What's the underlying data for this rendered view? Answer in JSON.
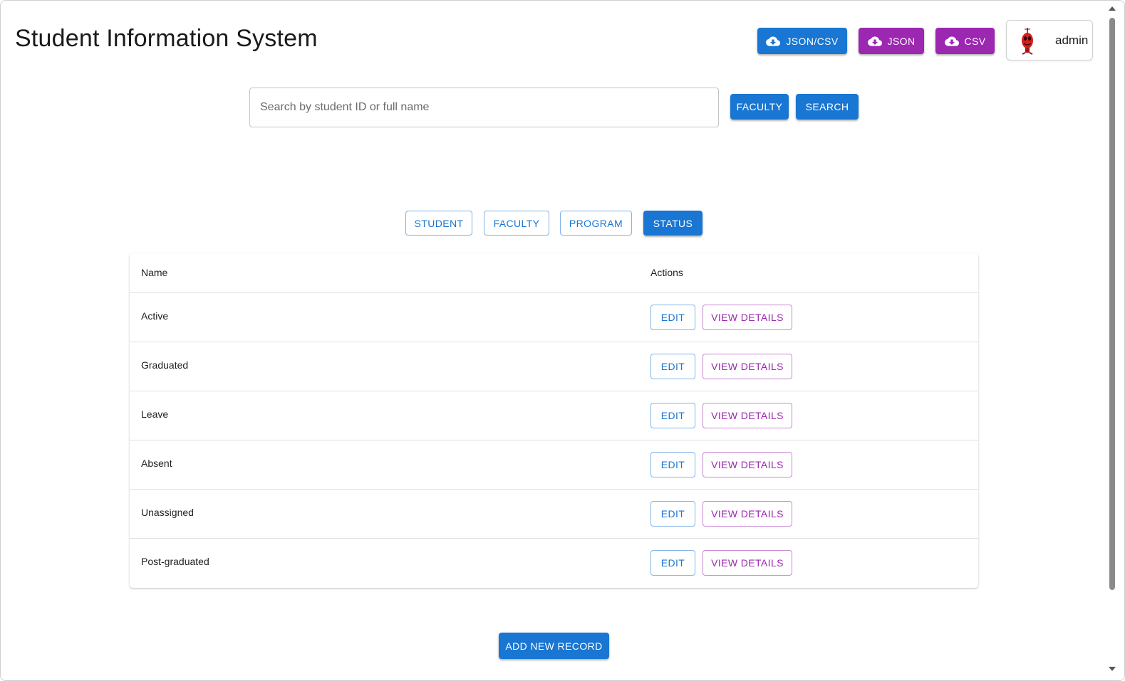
{
  "header": {
    "title": "Student Information System",
    "actions": [
      {
        "label": "JSON/CSV",
        "icon": "cloud-download-icon",
        "color": "#1976d2"
      },
      {
        "label": "JSON",
        "icon": "cloud-download-icon",
        "color": "#9c27b0"
      },
      {
        "label": "CSV",
        "icon": "cloud-download-icon",
        "color": "#9c27b0"
      }
    ],
    "user": {
      "name": "admin",
      "avatar": "avatar-icon"
    }
  },
  "search": {
    "placeholder": "Search by student ID or full name",
    "value": "",
    "faculty_label": "FACULTY",
    "search_label": "SEARCH"
  },
  "tabs": [
    {
      "label": "STUDENT",
      "active": false
    },
    {
      "label": "FACULTY",
      "active": false
    },
    {
      "label": "PROGRAM",
      "active": false
    },
    {
      "label": "STATUS",
      "active": true
    }
  ],
  "table": {
    "columns": [
      "Name",
      "Actions"
    ],
    "rows": [
      {
        "name": "Active",
        "edit": "EDIT",
        "view": "VIEW DETAILS"
      },
      {
        "name": "Graduated",
        "edit": "EDIT",
        "view": "VIEW DETAILS"
      },
      {
        "name": "Leave",
        "edit": "EDIT",
        "view": "VIEW DETAILS"
      },
      {
        "name": "Absent",
        "edit": "EDIT",
        "view": "VIEW DETAILS"
      },
      {
        "name": "Unassigned",
        "edit": "EDIT",
        "view": "VIEW DETAILS"
      },
      {
        "name": "Post-graduated",
        "edit": "EDIT",
        "view": "VIEW DETAILS"
      }
    ]
  },
  "footer": {
    "add_label": "ADD NEW RECORD"
  },
  "colors": {
    "primary": "#1976d2",
    "secondary": "#9c27b0"
  }
}
